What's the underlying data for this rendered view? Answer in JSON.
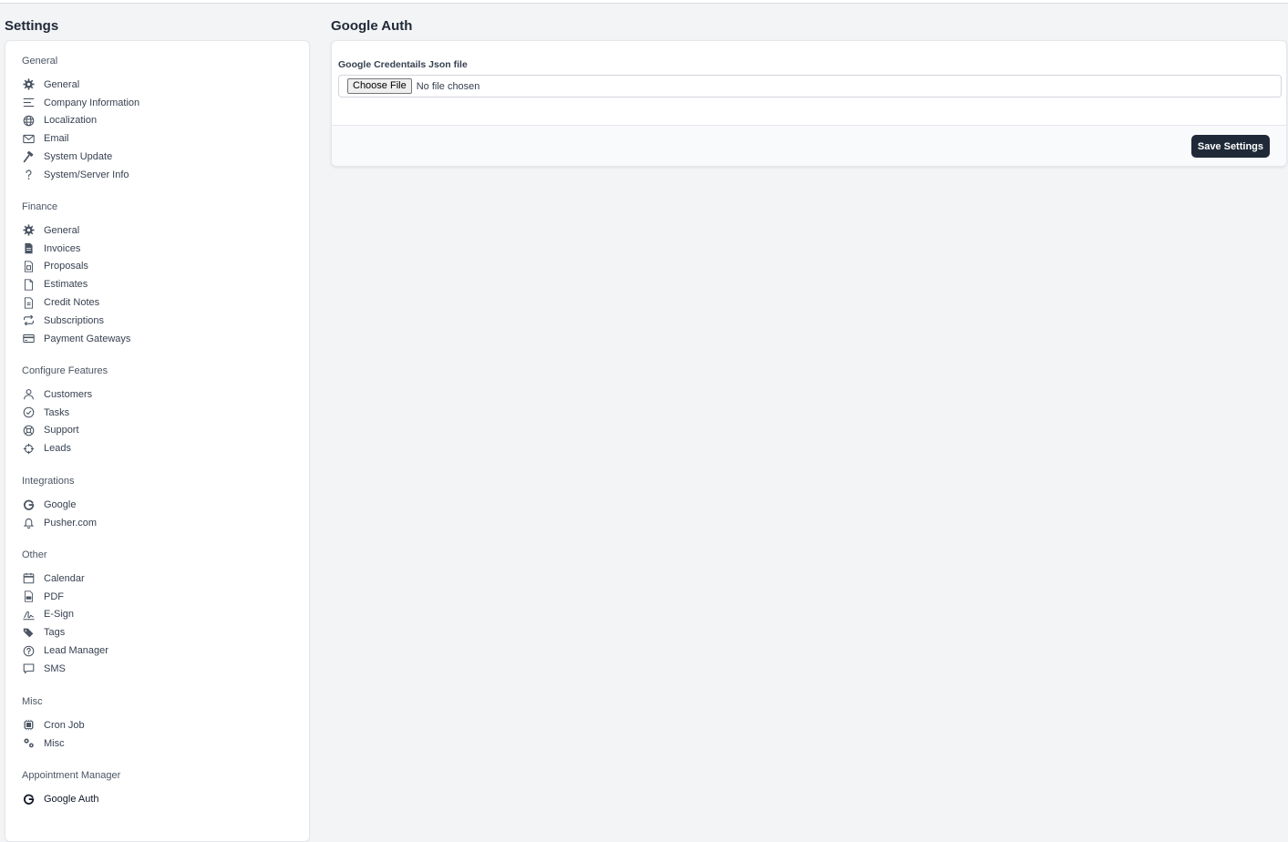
{
  "sidebar": {
    "title": "Settings",
    "groups": [
      {
        "title": "General",
        "items": [
          {
            "label": "General",
            "icon": "gear-icon"
          },
          {
            "label": "Company Information",
            "icon": "lines-icon"
          },
          {
            "label": "Localization",
            "icon": "globe-icon"
          },
          {
            "label": "Email",
            "icon": "envelope-icon"
          },
          {
            "label": "System Update",
            "icon": "hammer-icon"
          },
          {
            "label": "System/Server Info",
            "icon": "question-icon"
          }
        ]
      },
      {
        "title": "Finance",
        "items": [
          {
            "label": "General",
            "icon": "gear-icon"
          },
          {
            "label": "Invoices",
            "icon": "file-text-icon"
          },
          {
            "label": "Proposals",
            "icon": "file-icon"
          },
          {
            "label": "Estimates",
            "icon": "file-blank-icon"
          },
          {
            "label": "Credit Notes",
            "icon": "file-lines-icon"
          },
          {
            "label": "Subscriptions",
            "icon": "repeat-icon"
          },
          {
            "label": "Payment Gateways",
            "icon": "credit-card-icon"
          }
        ]
      },
      {
        "title": "Configure Features",
        "items": [
          {
            "label": "Customers",
            "icon": "user-icon"
          },
          {
            "label": "Tasks",
            "icon": "check-circle-icon"
          },
          {
            "label": "Support",
            "icon": "lifebuoy-icon"
          },
          {
            "label": "Leads",
            "icon": "crosshair-icon"
          }
        ]
      },
      {
        "title": "Integrations",
        "items": [
          {
            "label": "Google",
            "icon": "google-icon"
          },
          {
            "label": "Pusher.com",
            "icon": "bell-icon"
          }
        ]
      },
      {
        "title": "Other",
        "items": [
          {
            "label": "Calendar",
            "icon": "calendar-icon"
          },
          {
            "label": "PDF",
            "icon": "pdf-icon"
          },
          {
            "label": "E-Sign",
            "icon": "signature-icon"
          },
          {
            "label": "Tags",
            "icon": "tags-icon"
          },
          {
            "label": "Lead Manager",
            "icon": "question-circle-icon"
          },
          {
            "label": "SMS",
            "icon": "chat-icon"
          }
        ]
      },
      {
        "title": "Misc",
        "items": [
          {
            "label": "Cron Job",
            "icon": "chip-icon"
          },
          {
            "label": "Misc",
            "icon": "cogs-icon"
          }
        ]
      },
      {
        "title": "Appointment Manager",
        "items": [
          {
            "label": "Google Auth",
            "icon": "google-icon",
            "active": true
          }
        ]
      }
    ]
  },
  "main": {
    "title": "Google Auth",
    "field_label": "Google Credentails Json file",
    "choose_file_label": "Choose File",
    "file_status": "No file chosen",
    "save_label": "Save Settings"
  },
  "colors": {
    "background": "#f3f4f6",
    "panel": "#ffffff",
    "button_dark": "#1f2937",
    "text_muted": "#4b5563"
  }
}
